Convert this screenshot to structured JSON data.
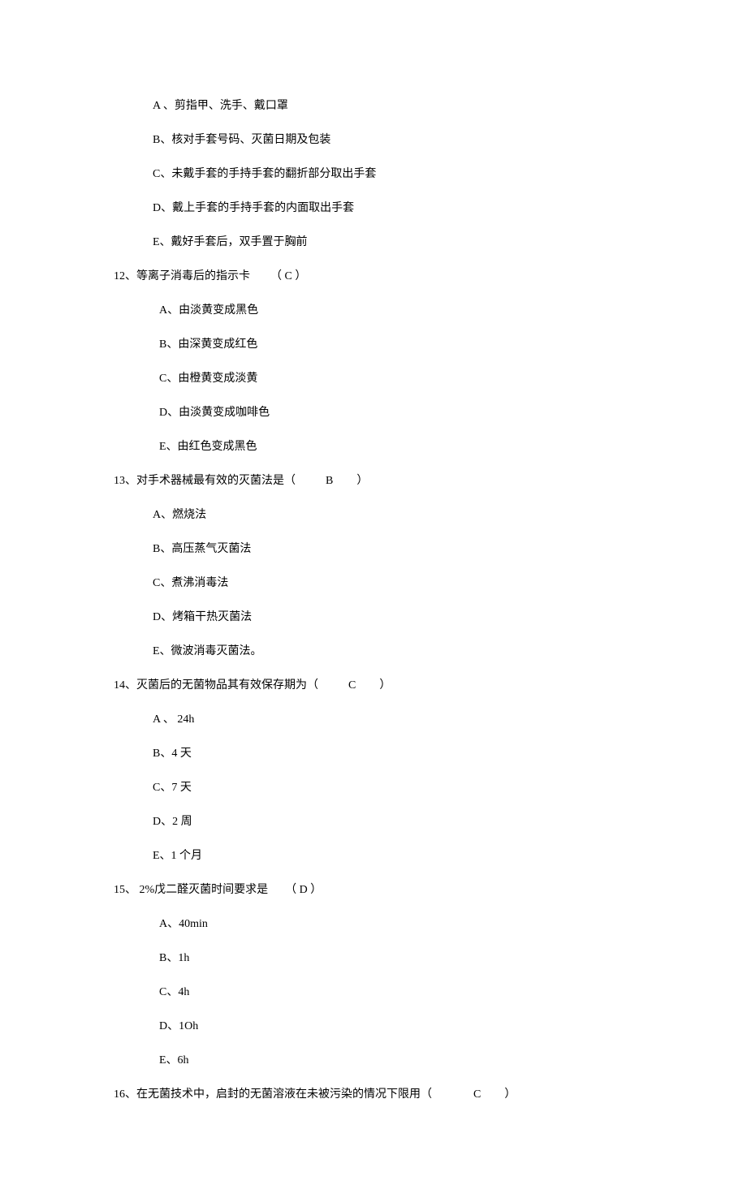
{
  "q11": {
    "options": {
      "A": "A  、剪指甲、洗手、戴口罩",
      "B": "B、核对手套号码、灭菌日期及包装",
      "C": "C、未戴手套的手持手套的翻折部分取出手套",
      "D": "D、戴上手套的手持手套的内面取出手套",
      "E": "E、戴好手套后，双手置于胸前"
    }
  },
  "q12": {
    "text_before": "12、等离子消毒后的指示卡",
    "answer": "（ C ）",
    "options": {
      "A": "A、由淡黄变成黑色",
      "B": "B、由深黄变成红色",
      "C": "C、由橙黄变成淡黄",
      "D": "D、由淡黄变成咖啡色",
      "E": "E、由红色变成黑色"
    }
  },
  "q13": {
    "text_before": "13、对手术器械最有效的灭菌法是（",
    "answer": "B",
    "text_after": "）",
    "options": {
      "A": "A、燃烧法",
      "B": "B、高压蒸气灭菌法",
      "C": "C、煮沸消毒法",
      "D": "D、烤箱干热灭菌法",
      "E": "E、微波消毒灭菌法。"
    }
  },
  "q14": {
    "text_before": "14、灭菌后的无菌物品其有效保存期为（",
    "answer": "C",
    "text_after": "）",
    "options": {
      "A": "A  、 24h",
      "B": "B、4 天",
      "C": "C、7 天",
      "D": "D、2 周",
      "E": "E、1 个月"
    }
  },
  "q15": {
    "text_before": "15、 2%戊二醛灭菌时间要求是",
    "answer": "（ D ）",
    "options": {
      "A": "A、40min",
      "B": "B、1h",
      "C": "C、4h",
      "D": "D、1Oh",
      "E": "E、6h"
    }
  },
  "q16": {
    "text_before": "16、在无菌技术中，启封的无菌溶液在未被污染的情况下限用（",
    "answer": "C",
    "text_after": "）"
  }
}
